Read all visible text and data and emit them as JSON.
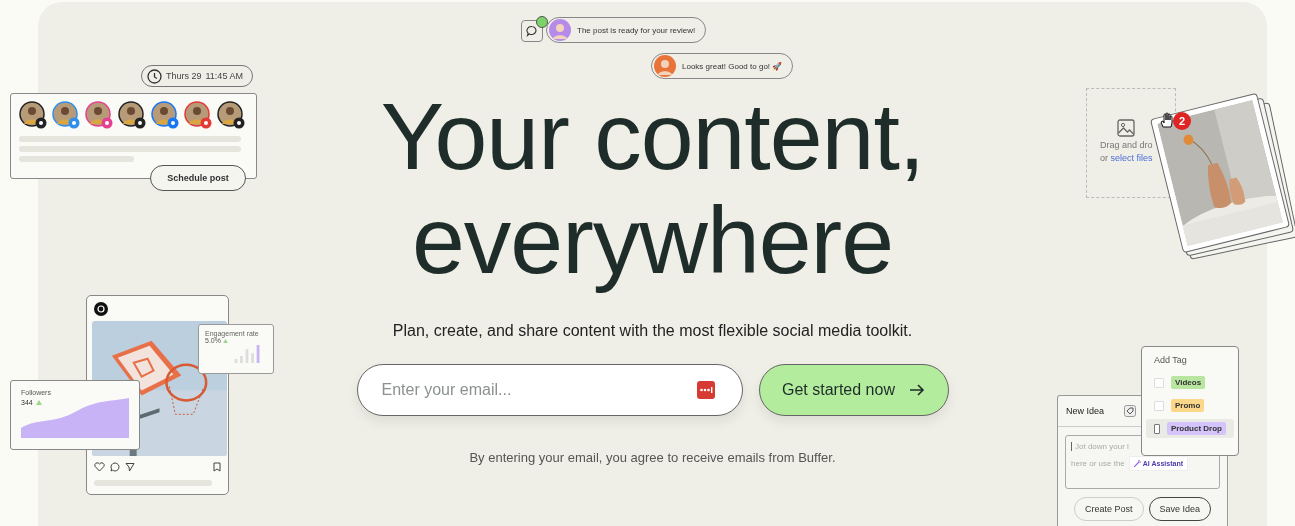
{
  "chat": {
    "messages": [
      {
        "text": "The post is ready for your review!"
      },
      {
        "text": "Looks great! Good to go! 🚀"
      }
    ]
  },
  "schedule": {
    "day": "Thurs 29",
    "time": "11:45 AM",
    "channels": [
      {
        "color": "#222222"
      },
      {
        "color": "#2f8fea"
      },
      {
        "color": "#e4408f"
      },
      {
        "color": "#222222"
      },
      {
        "color": "#1877f2"
      },
      {
        "color": "#e53935"
      },
      {
        "color": "#222222"
      }
    ],
    "button": "Schedule post"
  },
  "headline": [
    "Your content,",
    "everywhere"
  ],
  "subtitle": "Plan, create, and share content with the most flexible social media toolkit.",
  "email": {
    "placeholder": "Enter your email..."
  },
  "cta": "Get started now",
  "disclaimer": "By entering your email, you agree to receive emails from Buffer.",
  "upload": {
    "text": "Drag and dro",
    "prefix": "or",
    "link": "select files",
    "count": "2"
  },
  "post": {
    "followers_label": "Followers",
    "followers": "344",
    "engagement_label": "Engagement rate",
    "engagement": "5.0%"
  },
  "idea": {
    "title": "New Idea",
    "lines": [
      "Jot down your l",
      "here or use the"
    ],
    "assistant": "AI Assistant",
    "buttons": [
      "Create Post",
      "Save Idea"
    ]
  },
  "tags": {
    "title": "Add Tag",
    "items": [
      {
        "label": "Videos",
        "color": "#b8e6a0",
        "checked": false,
        "selected": false
      },
      {
        "label": "Promo",
        "color": "#fbd78a",
        "checked": false,
        "selected": false
      },
      {
        "label": "Product Drop",
        "color": "#d4c4fb",
        "checked": false,
        "selected": true
      }
    ]
  }
}
